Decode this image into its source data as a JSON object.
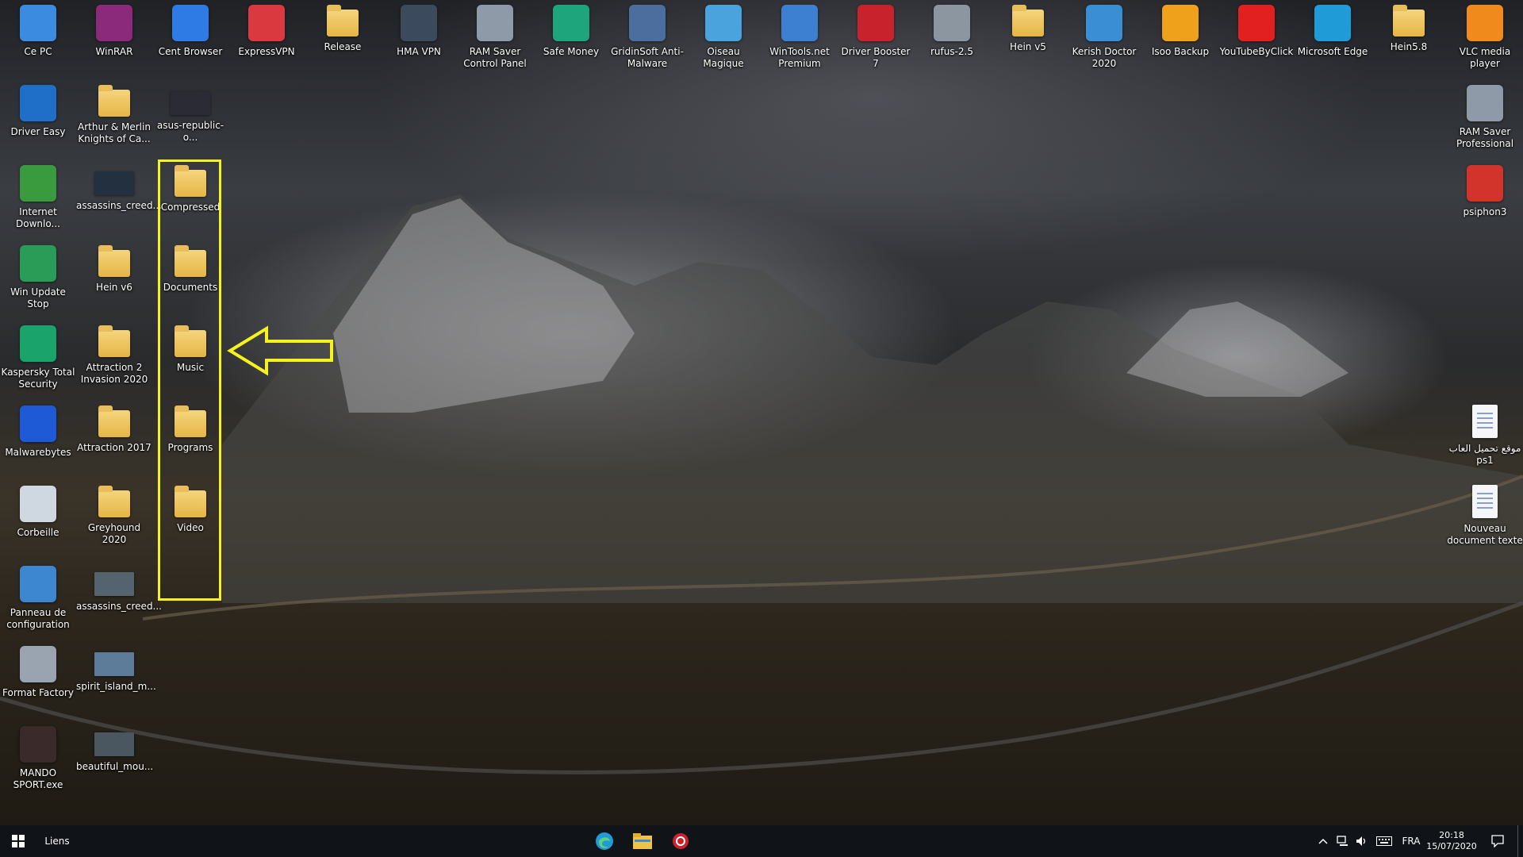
{
  "desktop": {
    "top_row": [
      {
        "label": "Ce PC",
        "icon": "computer-icon",
        "color": "#3b8be0"
      },
      {
        "label": "WinRAR",
        "icon": "winrar-icon",
        "color": "#8b2a7a"
      },
      {
        "label": "Cent Browser",
        "icon": "cent-browser-icon",
        "color": "#2f7be6"
      },
      {
        "label": "ExpressVPN",
        "icon": "expressvpn-icon",
        "color": "#da3940"
      },
      {
        "label": "Release",
        "icon": "folder-icon",
        "color": "#e8c060"
      },
      {
        "label": "HMA VPN",
        "icon": "hma-vpn-icon",
        "color": "#3b4a5c"
      },
      {
        "label": "RAM Saver Control Panel",
        "icon": "ram-saver-icon",
        "color": "#8e9aa8"
      },
      {
        "label": "Safe Money",
        "icon": "safe-money-icon",
        "color": "#1fa57b"
      },
      {
        "label": "GridinSoft Anti-Malware",
        "icon": "gridinsoft-icon",
        "color": "#4b6e9e"
      },
      {
        "label": "Oiseau Magique",
        "icon": "disc-icon",
        "color": "#4aa3dc"
      },
      {
        "label": "WinTools.net Premium",
        "icon": "wintools-icon",
        "color": "#3d7fd0"
      },
      {
        "label": "Driver Booster 7",
        "icon": "driver-booster-icon",
        "color": "#c8232c"
      },
      {
        "label": "rufus-2.5",
        "icon": "usb-drive-icon",
        "color": "#8c96a0"
      },
      {
        "label": "Hein v5",
        "icon": "folder-icon",
        "color": "#e8c060"
      },
      {
        "label": "Kerish Doctor 2020",
        "icon": "kerish-doctor-icon",
        "color": "#3a8ed4"
      },
      {
        "label": "Isoo Backup",
        "icon": "isoo-backup-icon",
        "color": "#f0a11b"
      },
      {
        "label": "YouTubeByClick",
        "icon": "youtube-icon",
        "color": "#e22020"
      },
      {
        "label": "Microsoft Edge",
        "icon": "edge-icon",
        "color": "#1f9bd8"
      },
      {
        "label": "Hein5.8",
        "icon": "folder-icon",
        "color": "#e8c060"
      },
      {
        "label": "VLC media player",
        "icon": "vlc-icon",
        "color": "#f08a1c"
      }
    ],
    "col1": [
      {
        "label": "Driver Easy",
        "icon": "driver-easy-icon",
        "color": "#1f6fc8"
      },
      {
        "label": "Internet Downlo...",
        "icon": "internet-download-manager-icon",
        "color": "#3a9b3e"
      },
      {
        "label": "Win Update Stop",
        "icon": "win-update-stop-icon",
        "color": "#2b9b58"
      },
      {
        "label": "Kaspersky Total Security",
        "icon": "kaspersky-icon",
        "color": "#1aa36b"
      },
      {
        "label": "Malwarebytes",
        "icon": "malwarebytes-icon",
        "color": "#1f5ad6"
      },
      {
        "label": "Corbeille",
        "icon": "recycle-bin-icon",
        "color": "#cfd8e0"
      },
      {
        "label": "Panneau de configuration",
        "icon": "control-panel-icon",
        "color": "#3d86d0"
      },
      {
        "label": "Format Factory",
        "icon": "format-factory-icon",
        "color": "#9aa4b0"
      },
      {
        "label": "MANDO SPORT.exe",
        "icon": "mando-sport-icon",
        "color": "#3a2a2a"
      }
    ],
    "col2": [
      {
        "label": "Arthur & Merlin Knights of Ca...",
        "icon": "folder-icon",
        "color": "#e8c060"
      },
      {
        "label": "assassins_creed...",
        "icon": "image-thumbnail-icon",
        "color": "#233040"
      },
      {
        "label": "Hein v6",
        "icon": "folder-icon",
        "color": "#e8c060"
      },
      {
        "label": "Attraction 2 Invasion 2020",
        "icon": "folder-icon",
        "color": "#e8c060"
      },
      {
        "label": "Attraction 2017",
        "icon": "folder-icon",
        "color": "#e8c060"
      },
      {
        "label": "Greyhound 2020",
        "icon": "folder-icon",
        "color": "#e8c060"
      },
      {
        "label": "assassins_creed...",
        "icon": "image-thumbnail-icon",
        "color": "#55636e"
      },
      {
        "label": "spirit_island_m...",
        "icon": "image-thumbnail-icon",
        "color": "#5d7c9a"
      },
      {
        "label": "beautiful_mou...",
        "icon": "image-thumbnail-icon",
        "color": "#4a5660"
      }
    ],
    "col3": [
      {
        "label": "asus-republic-o...",
        "icon": "image-thumbnail-icon",
        "color": "#2b2b36"
      },
      {
        "label": "Compressed",
        "icon": "folder-icon",
        "color": "#e8c060"
      },
      {
        "label": "Documents",
        "icon": "folder-icon",
        "color": "#e8c060"
      },
      {
        "label": "Music",
        "icon": "folder-icon",
        "color": "#e8c060"
      },
      {
        "label": "Programs",
        "icon": "folder-icon",
        "color": "#e8c060"
      },
      {
        "label": "Video",
        "icon": "folder-icon",
        "color": "#e8c060"
      }
    ],
    "right_col": [
      {
        "label": "RAM Saver Professional",
        "icon": "ram-saver-icon",
        "color": "#8e9aa8"
      },
      {
        "label": "psiphon3",
        "icon": "psiphon-icon",
        "color": "#d2342c"
      },
      {
        "label": "موقع تحميل العاب ps1",
        "icon": "text-document-icon",
        "color": "#f4f6fa"
      },
      {
        "label": "Nouveau document texte",
        "icon": "text-document-icon",
        "color": "#f4f6fa"
      }
    ],
    "highlight_color": "#f6f21c"
  },
  "taskbar": {
    "links_label": "Liens",
    "pinned": [
      {
        "name": "edge-icon",
        "color": "#1f9bd8"
      },
      {
        "name": "file-explorer-icon",
        "color": "#f0c24a"
      },
      {
        "name": "driver-booster-icon",
        "color": "#c8232c"
      }
    ],
    "language": "FRA",
    "time": "20:18",
    "date": "15/07/2020"
  }
}
